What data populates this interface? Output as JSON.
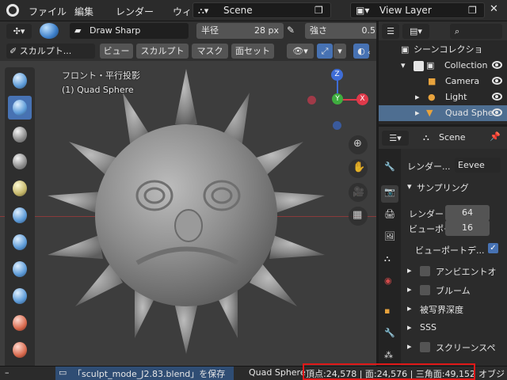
{
  "topbar": {
    "menus": [
      "ファイル",
      "編集",
      "レンダー",
      "ウィンド"
    ],
    "scene_name": "Scene",
    "view_layer_name": "View Layer"
  },
  "tool_header": {
    "brush_name": "Draw Sharp",
    "radius_label": "半径",
    "radius_value": "28 px",
    "strength_label": "強さ",
    "strength_value": "0.5"
  },
  "viewport_header": {
    "mode_label": "スカルプト...",
    "menus": [
      "ビュー",
      "スカルプト",
      "マスク",
      "面セット"
    ]
  },
  "viewport": {
    "view_name": "フロント・平行投影",
    "object_name": "(1) Quad Sphere",
    "gizmo": {
      "z": "Z",
      "y": "Y",
      "x": "X"
    }
  },
  "outliner": {
    "collection": "シーンコレクショ",
    "items": [
      {
        "label": "Collection"
      },
      {
        "label": "Camera"
      },
      {
        "label": "Light"
      },
      {
        "label": "Quad Sphe"
      }
    ]
  },
  "properties": {
    "scene_label": "Scene",
    "render_engine_label": "レンダー...",
    "render_engine_value": "Eevee",
    "sampling_panel": "サンプリング",
    "render_label": "レンダー",
    "render_value": "64",
    "viewport_label": "ビューポー...",
    "viewport_value": "16",
    "viewport_denoise_label": "ビューポートデ...",
    "panels": [
      "アンビエントオ",
      "ブルーム",
      "被写界深度",
      "SSS",
      "スクリーンスペ"
    ]
  },
  "statusbar": {
    "dash": "–",
    "saved_message": "「sculpt_mode_J2.83.blend」を保存",
    "object": "Quad Sphere",
    "stats": "頂点:24,578 | 面:24,576 | 三角面:49,152",
    "trailing": "オブジ"
  },
  "colors": {
    "accent": "#4772b3",
    "x_axis": "#e0394a",
    "y_axis": "#3fae3f",
    "z_axis": "#3f6dd6",
    "highlight": "#e01818"
  }
}
